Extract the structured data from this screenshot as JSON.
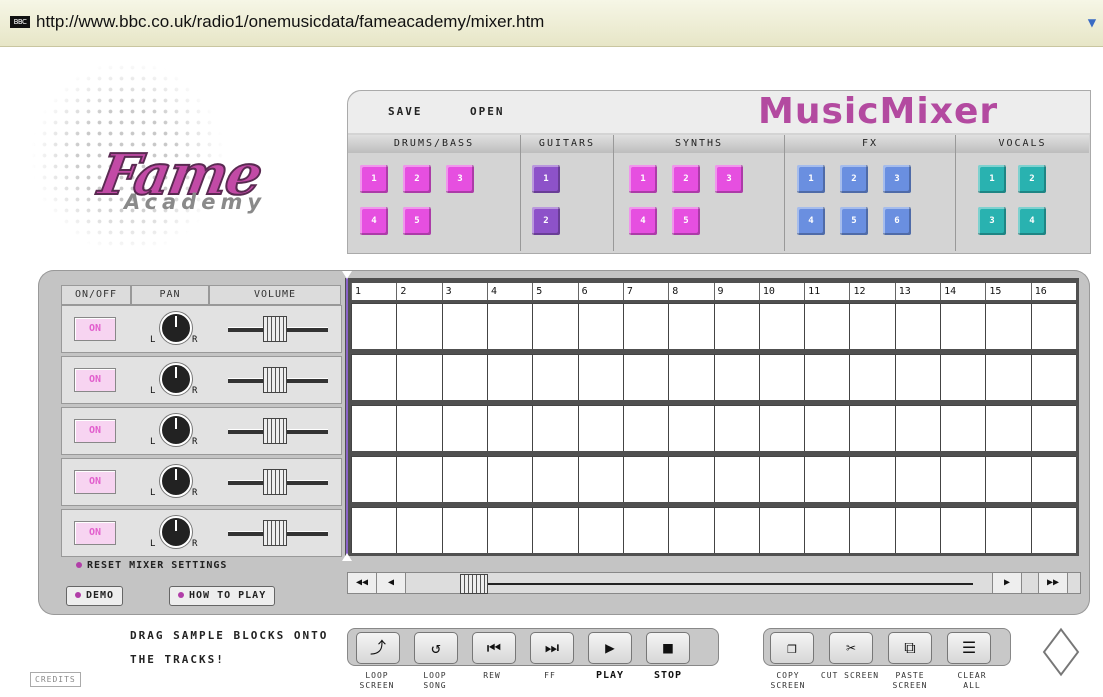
{
  "browser": {
    "icon_text": "BBC",
    "url": "http://www.bbc.co.uk/radio1/onemusicdata/fameacademy/mixer.htm",
    "dropdown_icon": "chevron-down-icon"
  },
  "logo": {
    "fame": "Fame",
    "academy": "Academy"
  },
  "app_title": "MusicMixer",
  "file_menu": {
    "save": "SAVE",
    "open": "OPEN"
  },
  "categories": [
    {
      "label": "DRUMS/BASS",
      "color": "#e64fe0"
    },
    {
      "label": "GUITARS",
      "color": "#8d52c9"
    },
    {
      "label": "SYNTHS",
      "color": "#e64fe0"
    },
    {
      "label": "FX",
      "color": "#6a8fe0"
    },
    {
      "label": "VOCALS",
      "color": "#29b2b0"
    }
  ],
  "samples": {
    "drums": [
      "1",
      "2",
      "3",
      "4",
      "5"
    ],
    "guitars": [
      "1",
      "2"
    ],
    "synths": [
      "1",
      "2",
      "3",
      "4",
      "5"
    ],
    "fx": [
      "1",
      "2",
      "3",
      "4",
      "5",
      "6"
    ],
    "vocals": [
      "1",
      "2",
      "3",
      "4"
    ]
  },
  "mixer_headers": {
    "onoff": "ON/OFF",
    "pan": "PAN",
    "volume": "VOLUME"
  },
  "track_labels": {
    "on": "ON",
    "left": "L",
    "right": "R"
  },
  "tracks": [
    1,
    2,
    3,
    4,
    5
  ],
  "timeline": [
    "1",
    "2",
    "3",
    "4",
    "5",
    "6",
    "7",
    "8",
    "9",
    "10",
    "11",
    "12",
    "13",
    "14",
    "15",
    "16"
  ],
  "reset": "RESET MIXER SETTINGS",
  "demo": "DEMO",
  "how_to_play": "HOW TO PLAY",
  "scroll": {
    "first": "◀◀",
    "prev": "◀",
    "next": "▶",
    "last": "▶▶"
  },
  "instructions": "DRAG SAMPLE BLOCKS ONTO THE TRACKS!",
  "credits": "CREDITS",
  "transport": {
    "loop_screen": "LOOP SCREEN",
    "loop_song": "LOOP SONG",
    "rew": "REW",
    "ff": "FF",
    "play": "PLAY",
    "stop": "STOP"
  },
  "edit": {
    "copy_screen": "COPY SCREEN",
    "cut_screen": "CUT SCREEN",
    "paste_screen": "PASTE SCREEN",
    "clear_all": "CLEAR ALL"
  }
}
